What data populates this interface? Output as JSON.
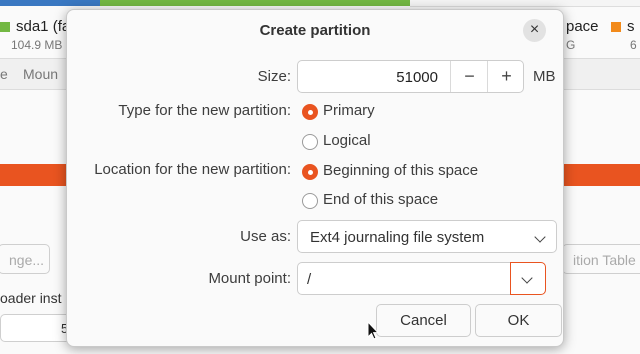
{
  "background": {
    "legend_left": {
      "name": "sda1 (fa",
      "size": "104.9 MB",
      "swatch": "#73b843"
    },
    "legend_mid": {
      "name": "pace",
      "size": "G"
    },
    "legend_right": {
      "name": "s",
      "size": "6",
      "swatch": "#f28a1a"
    },
    "header_left": "e",
    "header_mount": "Moun",
    "change_button": "nge...",
    "new_table_button": "ition Table",
    "bootloader_label": "oader inst",
    "bootloader_device": "5"
  },
  "dialog": {
    "title": "Create partition",
    "close_glyph": "×",
    "size": {
      "label": "Size:",
      "value": "51000",
      "minus": "−",
      "plus": "+",
      "unit": "MB"
    },
    "type": {
      "label": "Type for the new partition:",
      "options": [
        {
          "label": "Primary",
          "selected": true
        },
        {
          "label": "Logical",
          "selected": false
        }
      ]
    },
    "location": {
      "label": "Location for the new partition:",
      "options": [
        {
          "label": "Beginning of this space",
          "selected": true
        },
        {
          "label": "End of this space",
          "selected": false
        }
      ]
    },
    "use_as": {
      "label": "Use as:",
      "value": "Ext4 journaling file system"
    },
    "mount_point": {
      "label": "Mount point:",
      "value": "/"
    },
    "cancel_button": "Cancel",
    "ok_button": "OK"
  },
  "colors": {
    "accent": "#e95420",
    "partition_used": "#73b843",
    "partition_blue": "#3a78c2"
  },
  "icons": {
    "close": "close-icon",
    "minus": "minus-icon",
    "plus": "plus-icon",
    "dropdown": "chevron-down-icon",
    "cursor": "mouse-pointer-icon"
  }
}
